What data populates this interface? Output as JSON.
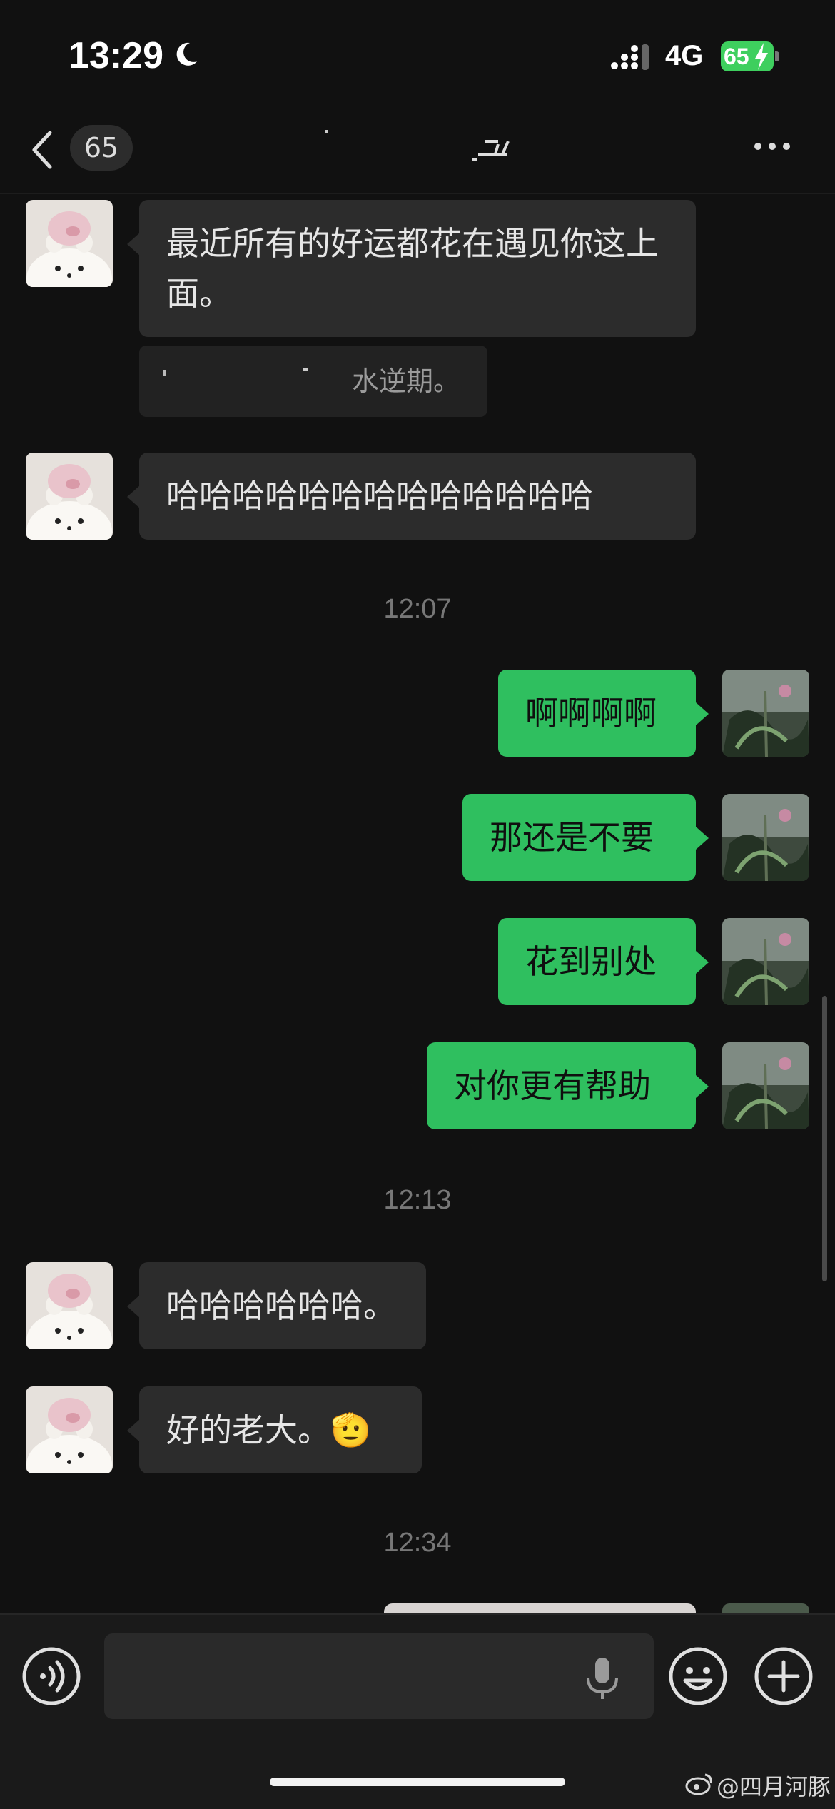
{
  "status_bar": {
    "time": "13:29",
    "network": "4G",
    "battery": "65",
    "battery_color": "#3ecf5e"
  },
  "nav": {
    "unread_count": "65",
    "title": ""
  },
  "messages": [
    {
      "side": "in",
      "text": "最近所有的好运都花在遇见你这上面。"
    },
    {
      "side": "in",
      "quote": "水逆期。"
    },
    {
      "side": "in",
      "text": "哈哈哈哈哈哈哈哈哈哈哈哈哈"
    },
    {
      "timestamp": "12:07"
    },
    {
      "side": "out",
      "text": "啊啊啊啊"
    },
    {
      "side": "out",
      "text": "那还是不要"
    },
    {
      "side": "out",
      "text": "花到别处"
    },
    {
      "side": "out",
      "text": "对你更有帮助"
    },
    {
      "timestamp": "12:13"
    },
    {
      "side": "in",
      "text": "哈哈哈哈哈哈。"
    },
    {
      "side": "in",
      "text": "好的老大。",
      "emoji": "🫡"
    },
    {
      "timestamp": "12:34"
    }
  ],
  "input": {
    "value": "",
    "icons": [
      "voice-icon",
      "mic-icon",
      "emoji-icon",
      "plus-icon"
    ]
  },
  "watermark": "@四月河豚",
  "colors": {
    "outgoing_bubble": "#2fbf5f",
    "incoming_bubble": "#2c2c2c",
    "background": "#111111"
  }
}
